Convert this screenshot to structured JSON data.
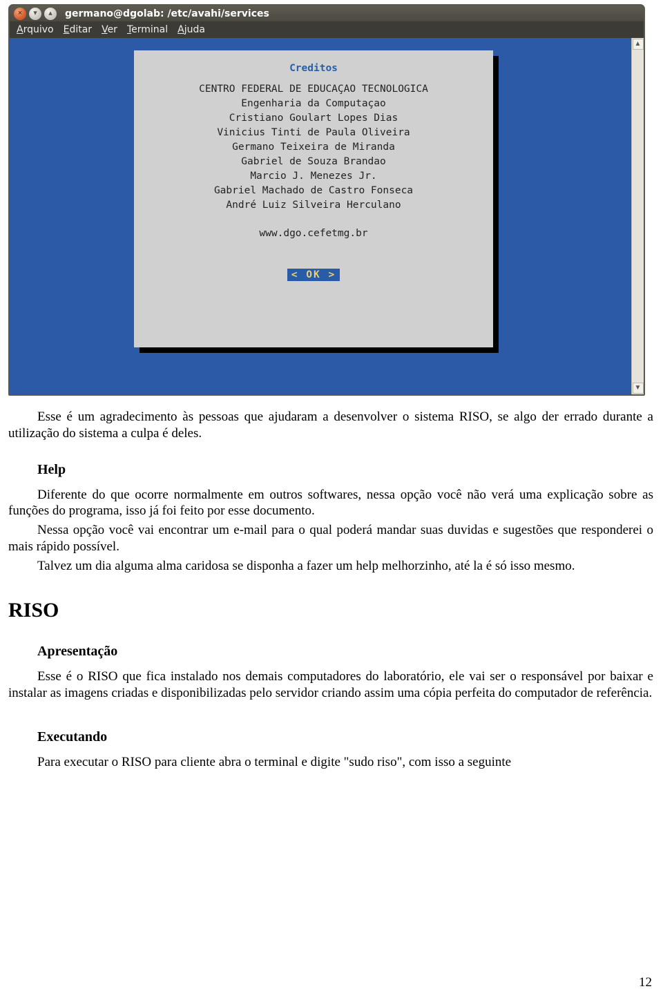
{
  "terminal": {
    "title": "germano@dgolab: /etc/avahi/services",
    "window_buttons": {
      "close": "×",
      "min": "▾",
      "max": "▴"
    },
    "menu": [
      "Arquivo",
      "Editar",
      "Ver",
      "Terminal",
      "Ajuda"
    ],
    "scroll": {
      "up": "▲",
      "down": "▼"
    },
    "dialog": {
      "title": "Creditos",
      "lines": [
        "CENTRO FEDERAL DE EDUCAÇAO TECNOLOGICA",
        "Engenharia da Computaçao",
        "",
        "Cristiano Goulart Lopes Dias",
        "Vinicius Tinti de Paula Oliveira",
        "Germano Teixeira de Miranda",
        "Gabriel de Souza Brandao",
        "Marcio J. Menezes Jr.",
        "Gabriel Machado de Castro Fonseca",
        "André Luiz Silveira Herculano"
      ],
      "url": "www.dgo.cefetmg.br",
      "ok": "< OK >"
    }
  },
  "doc": {
    "p1": "Esse é um agradecimento às pessoas que ajudaram a desenvolver o sistema RISO, se algo der errado durante a utilização do sistema a culpa é deles.",
    "h_help": "Help",
    "p2": "Diferente do que ocorre normalmente em outros softwares, nessa opção você não verá uma explicação sobre as funções do programa, isso já foi feito por esse documento.",
    "p3": "Nessa opção você vai encontrar um e-mail para o qual poderá mandar suas duvidas e sugestões que responderei o mais rápido possível.",
    "p4": "Talvez um dia alguma alma caridosa se disponha a fazer um help melhorzinho, até la é só isso mesmo.",
    "h_riso": "RISO",
    "h_apres": "Apresentação",
    "p5": "Esse é o RISO que fica instalado nos demais computadores do laboratório, ele vai ser o responsável por baixar e instalar as imagens criadas e disponibilizadas pelo servidor criando assim uma cópia perfeita do computador de referência.",
    "h_exec": "Executando",
    "p6": "Para executar o RISO para cliente abra o terminal e digite \"sudo riso\", com isso a seguinte",
    "page": "12"
  }
}
